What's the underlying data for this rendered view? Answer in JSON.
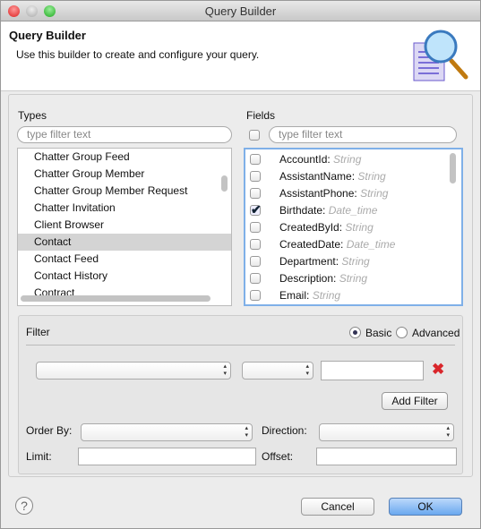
{
  "window": {
    "title": "Query Builder"
  },
  "header": {
    "title": "Query Builder",
    "subtitle": "Use this builder to create and configure your query."
  },
  "types": {
    "label": "Types",
    "placeholder": "type filter text",
    "items": [
      "Chatter Group Feed",
      "Chatter Group Member",
      "Chatter Group Member Request",
      "Chatter Invitation",
      "Client Browser",
      "Contact",
      "Contact Feed",
      "Contact History",
      "Contract"
    ],
    "selected": "Contact"
  },
  "fields": {
    "label": "Fields",
    "placeholder": "type filter text",
    "items": [
      {
        "name": "AccountId:",
        "type": "String",
        "checked": false
      },
      {
        "name": "AssistantName:",
        "type": "String",
        "checked": false
      },
      {
        "name": "AssistantPhone:",
        "type": "String",
        "checked": false
      },
      {
        "name": "Birthdate:",
        "type": "Date_time",
        "checked": true
      },
      {
        "name": "CreatedById:",
        "type": "String",
        "checked": false
      },
      {
        "name": "CreatedDate:",
        "type": "Date_time",
        "checked": false
      },
      {
        "name": "Department:",
        "type": "String",
        "checked": false
      },
      {
        "name": "Description:",
        "type": "String",
        "checked": false
      },
      {
        "name": "Email:",
        "type": "String",
        "checked": false
      }
    ]
  },
  "filter": {
    "label": "Filter",
    "basic": "Basic",
    "advanced": "Advanced",
    "mode": "Basic",
    "field_value": "",
    "operator_value": "",
    "value": "",
    "add_filter": "Add Filter",
    "order_by_label": "Order By:",
    "order_by_value": "",
    "direction_label": "Direction:",
    "direction_value": "",
    "limit_label": "Limit:",
    "limit_value": "",
    "offset_label": "Offset:",
    "offset_value": ""
  },
  "footer": {
    "cancel": "Cancel",
    "ok": "OK",
    "help_icon": "question-icon"
  },
  "colors": {
    "accent": "#5b9be6",
    "remove": "#d9262b"
  }
}
